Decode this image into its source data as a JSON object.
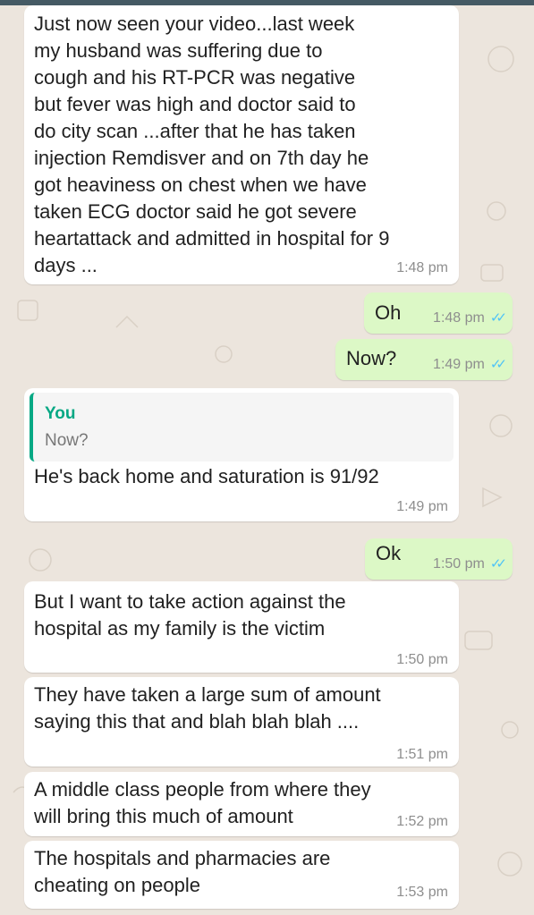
{
  "messages": [
    {
      "dir": "in",
      "text": "Just now seen your video...last week\nmy husband was suffering due to\ncough and his RT-PCR was negative\nbut fever was high and doctor said to\ndo city scan ...after that he has taken\ninjection Remdisver and on 7th day he\ngot heaviness on chest when we have\ntaken ECG doctor said he got severe\nheartattack and admitted in hospital for 9\ndays ...",
      "time": "1:48 pm"
    },
    {
      "dir": "out",
      "text": "Oh",
      "time": "1:48 pm"
    },
    {
      "dir": "out",
      "text": "Now?",
      "time": "1:49 pm"
    },
    {
      "dir": "in",
      "quote": {
        "author": "You",
        "text": "Now?"
      },
      "text": "He's back home and saturation is 91/92",
      "time": "1:49 pm"
    },
    {
      "dir": "out",
      "text": "Ok",
      "time": "1:50 pm"
    },
    {
      "dir": "in",
      "text": "But I want to take action against the\nhospital as my family is the victim",
      "time": "1:50 pm"
    },
    {
      "dir": "in",
      "text": "They have taken a large sum of amount\nsaying this that and blah blah blah ....",
      "time": "1:51 pm"
    },
    {
      "dir": "in",
      "text": "A middle class people from where they\nwill bring this much of  amount",
      "time": "1:52 pm"
    },
    {
      "dir": "in",
      "text": "The hospitals and pharmacies are\ncheating on people",
      "time": "1:53 pm"
    }
  ],
  "colors": {
    "incoming": "#ffffff",
    "outgoing": "#dcf8c6",
    "read_ticks": "#4fc3f7",
    "quote_accent": "#06a884",
    "background": "#ece5dd"
  },
  "icons": {
    "read_receipt": "double-check-icon"
  }
}
